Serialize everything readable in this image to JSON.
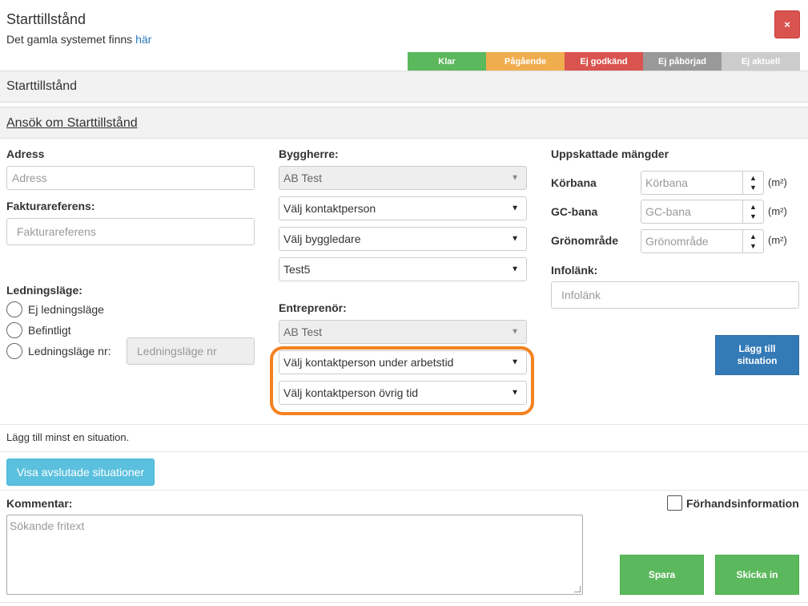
{
  "header": {
    "title": "Starttillstånd",
    "subtitle_text": "Det gamla systemet finns ",
    "subtitle_link": "här",
    "close_label": "×"
  },
  "status_legend": [
    {
      "label": "Klar",
      "color": "#5cb85c"
    },
    {
      "label": "Pågående",
      "color": "#f0ad4e"
    },
    {
      "label": "Ej godkänd",
      "color": "#d9534f"
    },
    {
      "label": "Ej påbörjad",
      "color": "#999999"
    },
    {
      "label": "Ej aktuell",
      "color": "#cccccc"
    }
  ],
  "sections": {
    "main": "Starttillstånd",
    "apply": "Ansök om Starttillstånd"
  },
  "left": {
    "address_label": "Adress",
    "address_placeholder": "Adress",
    "invoice_label": "Fakturareferens:",
    "invoice_placeholder": "Fakturareferens",
    "line_label": "Ledningsläge:",
    "radio_none": "Ej ledningsläge",
    "radio_existing": "Befintligt",
    "radio_nr": "Ledningsläge nr:",
    "line_nr_placeholder": "Ledningsläge nr"
  },
  "middle": {
    "builder_label": "Byggherre:",
    "builder_value": "AB Test",
    "contact_select": "Välj kontaktperson",
    "site_manager_select": "Välj byggledare",
    "test5_select": "Test5",
    "contractor_label": "Entreprenör:",
    "contractor_value": "AB Test",
    "contact_worktime": "Välj kontaktperson under arbetstid",
    "contact_other": "Välj kontaktperson övrig tid"
  },
  "right": {
    "amounts_label": "Uppskattade mängder",
    "road_label": "Körbana",
    "road_placeholder": "Körbana",
    "gc_label": "GC-bana",
    "gc_placeholder": "GC-bana",
    "green_label": "Grönområde",
    "green_placeholder": "Grönområde",
    "unit": "(m²)",
    "infolink_label": "Infolänk:",
    "infolink_placeholder": "Infolänk",
    "add_situation_line1": "Lägg till",
    "add_situation_line2": "situation"
  },
  "situation_note": "Lägg till minst en situation.",
  "show_completed_label": "Visa avslutade situationer",
  "comment_label": "Kommentar:",
  "comment_placeholder": "Sökande fritext",
  "preinfo_label": "Förhandsinformation",
  "save_label": "Spara",
  "send_label": "Skicka in",
  "colors": {
    "highlight": "#f58220",
    "primary": "#337ab7",
    "info": "#5bc0de",
    "success": "#5cb85c"
  }
}
